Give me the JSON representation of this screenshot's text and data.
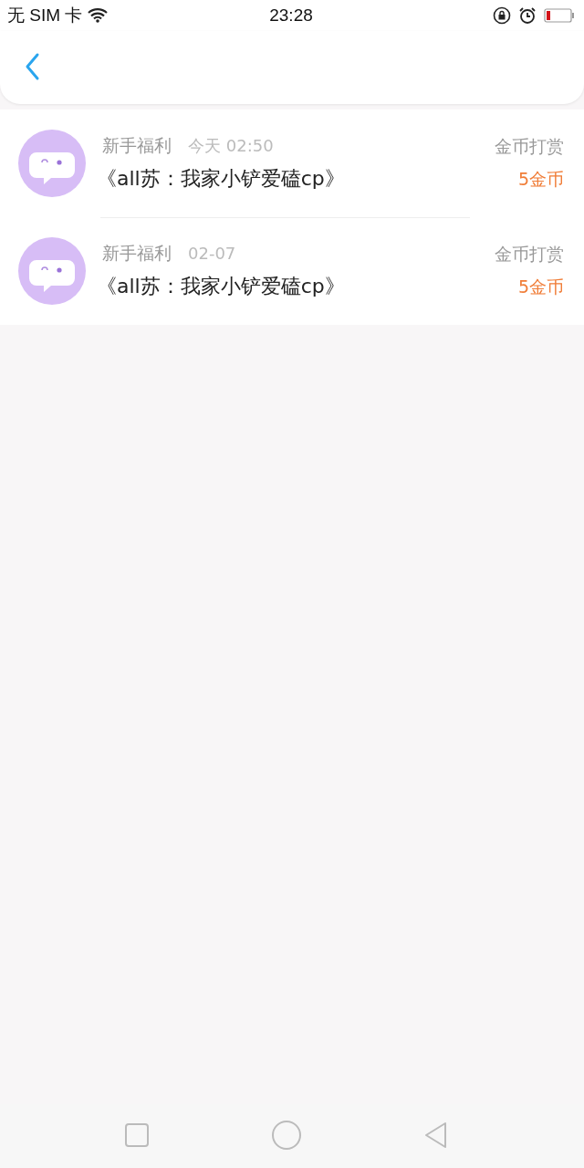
{
  "status_bar": {
    "carrier": "无 SIM 卡",
    "time": "23:28"
  },
  "items": [
    {
      "category": "新手福利",
      "time": "今天 02:50",
      "title": "《all苏：我家小铲爱磕cp》",
      "type": "金币打赏",
      "amount": "5金币"
    },
    {
      "category": "新手福利",
      "time": "02-07",
      "title": "《all苏：我家小铲爱磕cp》",
      "type": "金币打赏",
      "amount": "5金币"
    }
  ]
}
